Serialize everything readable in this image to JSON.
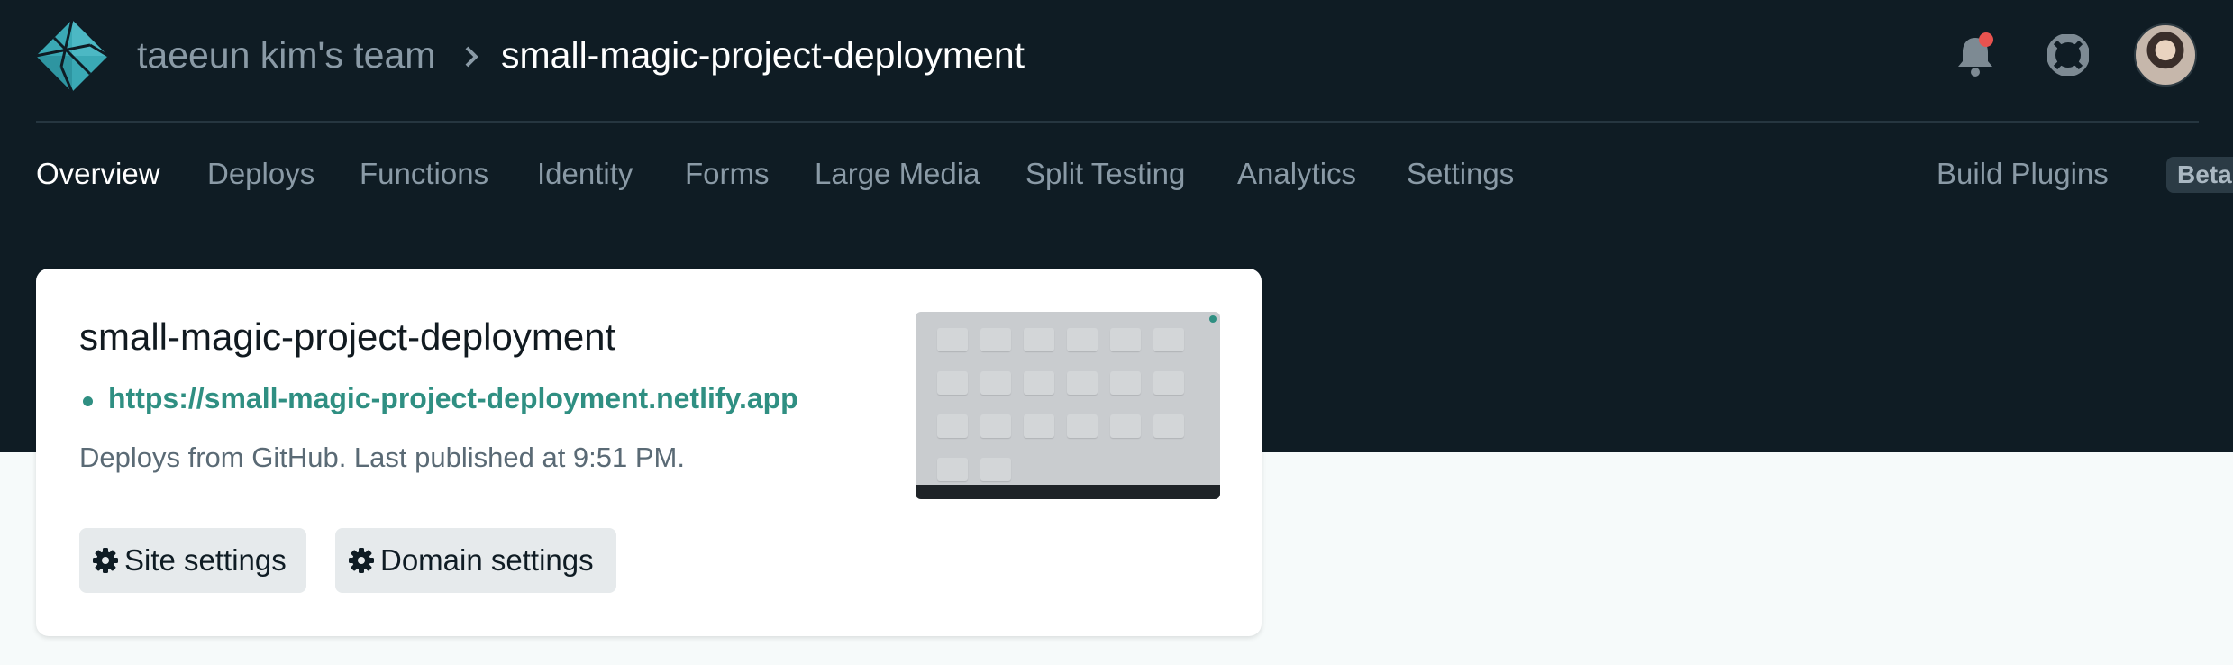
{
  "header": {
    "team_name": "taeeun kim's team",
    "site_name": "small-magic-project-deployment"
  },
  "nav": {
    "tabs": [
      {
        "label": "Overview",
        "active": true
      },
      {
        "label": "Deploys",
        "active": false
      },
      {
        "label": "Functions",
        "active": false
      },
      {
        "label": "Identity",
        "active": false
      },
      {
        "label": "Forms",
        "active": false
      },
      {
        "label": "Large Media",
        "active": false
      },
      {
        "label": "Split Testing",
        "active": false
      },
      {
        "label": "Analytics",
        "active": false
      },
      {
        "label": "Settings",
        "active": false
      }
    ],
    "build_plugins": {
      "label": "Build Plugins",
      "badge": "Beta"
    }
  },
  "card": {
    "title": "small-magic-project-deployment",
    "url": "https://small-magic-project-deployment.netlify.app",
    "deploy_info": "Deploys from GitHub. Last published at 9:51 PM.",
    "site_settings_label": "Site settings",
    "domain_settings_label": "Domain settings"
  },
  "icons": {
    "logo": "netlify-logo-icon",
    "separator": "chevron-right-icon",
    "notifications": "bell-icon",
    "help": "lifebuoy-icon",
    "gear": "gear-icon"
  },
  "colors": {
    "header_bg": "#0f1c24",
    "accent_teal": "#2f8f82",
    "notification_dot": "#e8534f",
    "page_bg": "#f6fafa"
  }
}
